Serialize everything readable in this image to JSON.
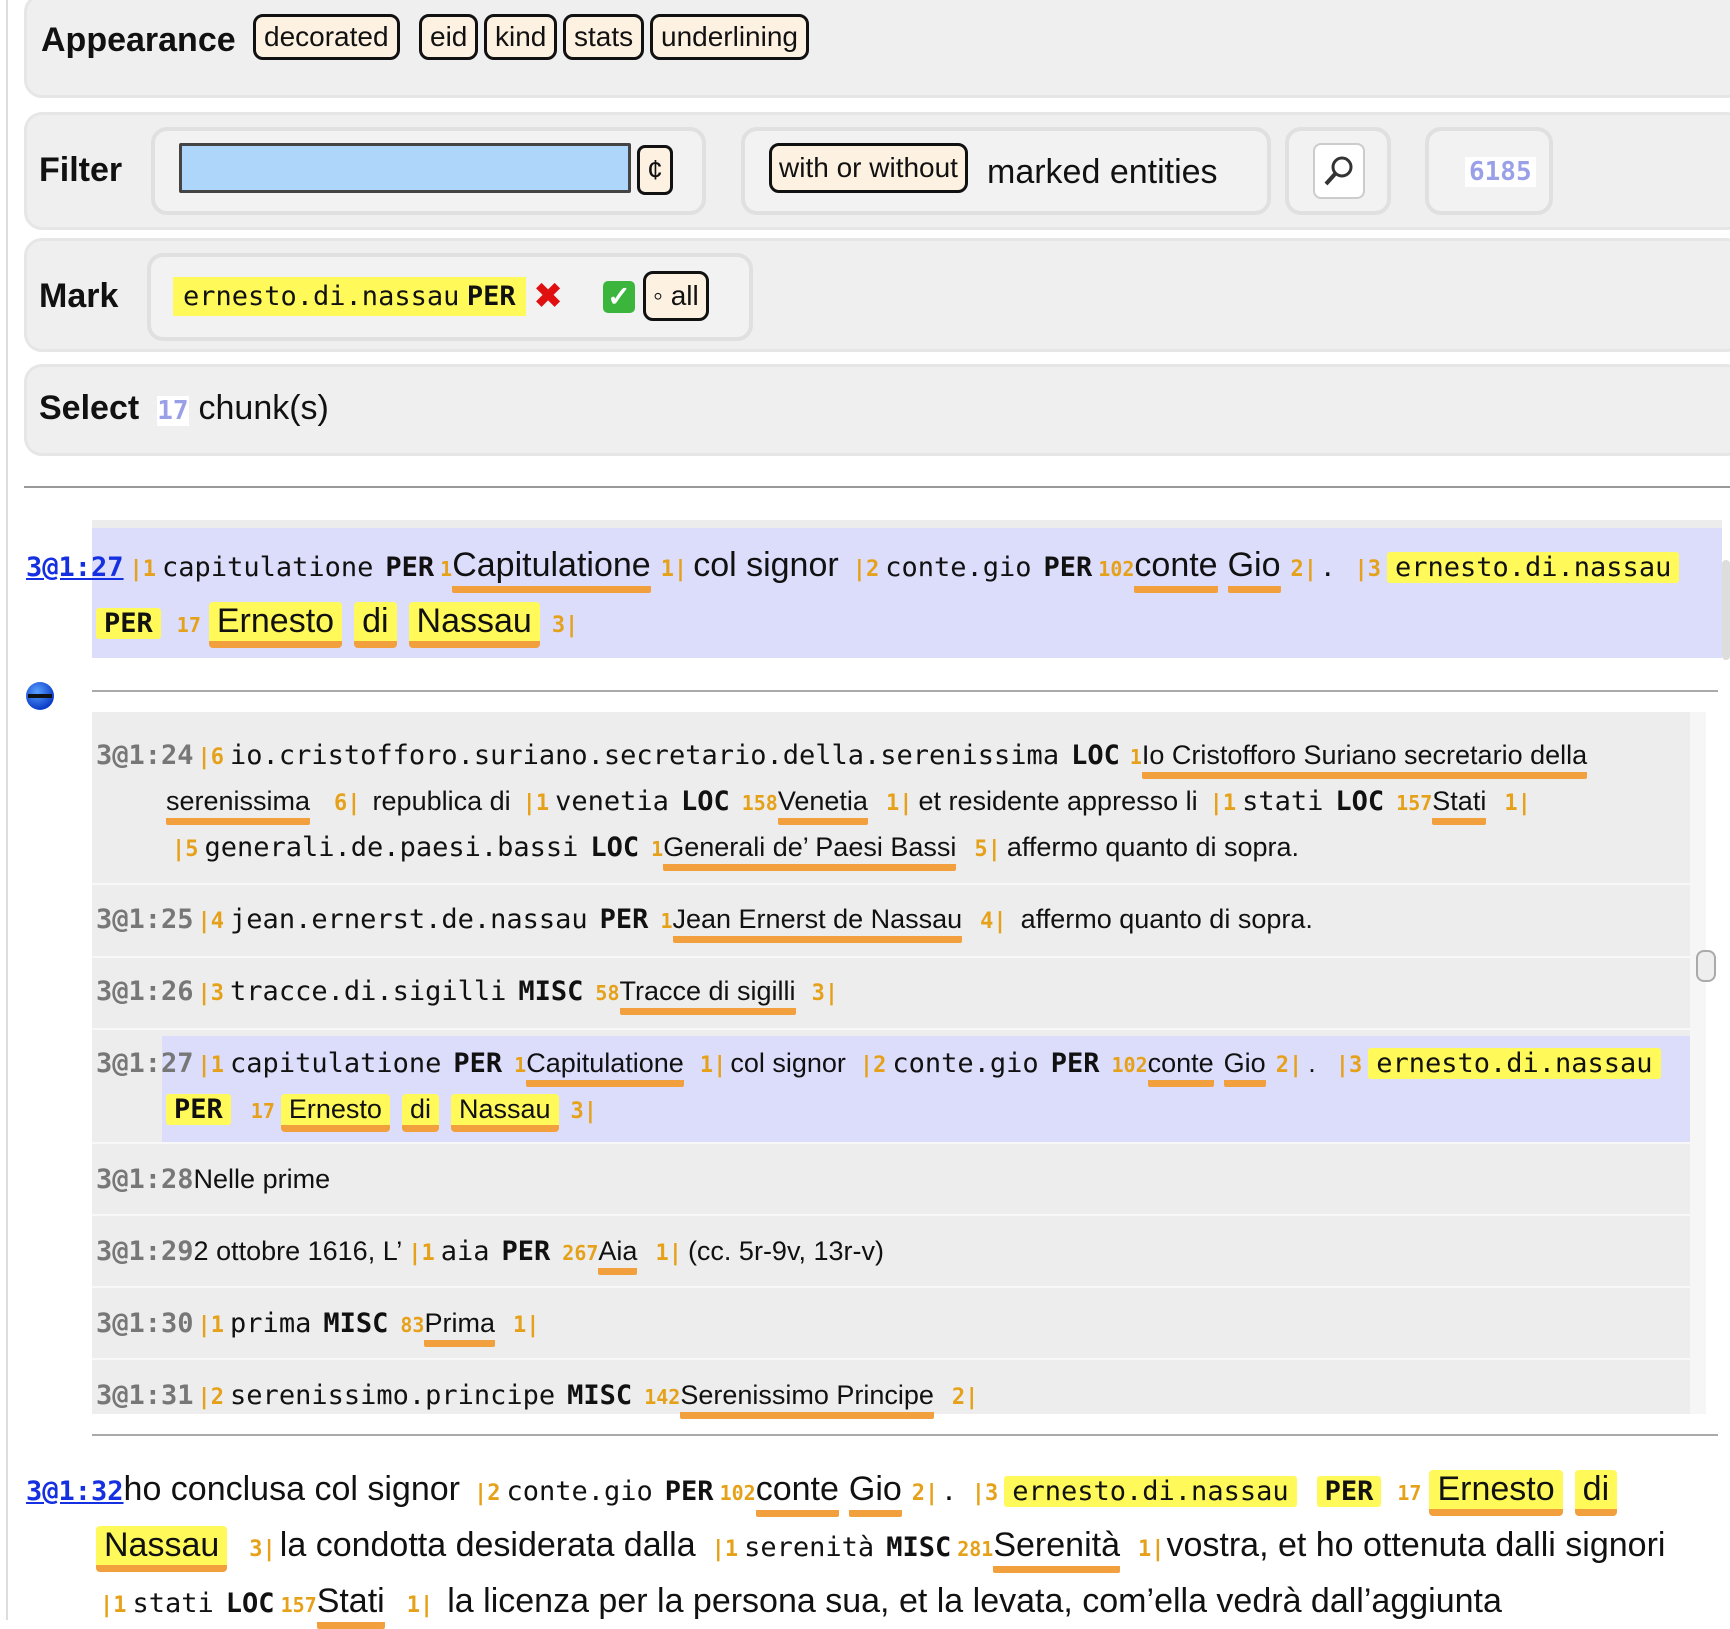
{
  "appearance": {
    "label": "Appearance",
    "options": [
      "decorated",
      "eid",
      "kind",
      "stats",
      "underlining"
    ]
  },
  "filter": {
    "label": "Filter",
    "search_value": "",
    "cent_button": "¢",
    "with_button": "with or without",
    "marked_text": "marked entities",
    "search_icon": "magnifier-icon",
    "count": "6185"
  },
  "mark": {
    "label": "Mark",
    "entity_eid": "ernesto.di.nassau",
    "entity_kind": "PER",
    "remove_glyph": "✖",
    "confirm_glyph": "✅",
    "all_button": "◦ all"
  },
  "select": {
    "label": "Select",
    "count": "17",
    "suffix": "chunk(s)"
  },
  "result": {
    "node": "3@1:27",
    "entities": [
      {
        "bar": "1",
        "eid": "capitulatione",
        "kind": "PER",
        "count": "1",
        "text": "Capitulatione",
        "close": "1"
      },
      {
        "plain": "col signor"
      },
      {
        "bar": "2",
        "eid": "conte.gio",
        "kind": "PER",
        "count": "102",
        "text": [
          "conte",
          "Gio"
        ],
        "close": "2"
      },
      {
        "plain": "."
      },
      {
        "bar": "3",
        "eid": "ernesto.di.nassau",
        "kind": "PER",
        "count": "17",
        "text": [
          "Ernesto",
          "di",
          "Nassau"
        ],
        "close": "3"
      }
    ]
  },
  "context": {
    "toggle_icon": "collapse-icon",
    "rows": [
      {
        "node": "3@1:24",
        "l1": [
          "6",
          "io.cristofforo.suriano.secretario.della.serenissima",
          "LOC",
          "1",
          "Io Cristofforo Suriano secretario della"
        ],
        "l2": [
          "serenissima",
          "6",
          "republica di",
          "1",
          "venetia",
          "LOC",
          "158",
          "Venetia",
          "1",
          "et residente appresso li",
          "1",
          "stati",
          "LOC",
          "157",
          "Stati",
          "1"
        ],
        "l3": [
          "5",
          "generali.de.paesi.bassi",
          "LOC",
          "1",
          "Generali de’ Paesi Bassi",
          "5",
          "affermo quanto di sopra."
        ]
      },
      {
        "node": "3@1:25",
        "bar": "4",
        "eid": "jean.ernerst.de.nassau",
        "kind": "PER",
        "count": "1",
        "text": "Jean Ernerst de Nassau",
        "close": "4",
        "after": "affermo quanto di sopra."
      },
      {
        "node": "3@1:26",
        "bar": "3",
        "eid": "tracce.di.sigilli",
        "kind": "MISC",
        "count": "58",
        "text": "Tracce di sigilli",
        "close": "3"
      },
      {
        "node": "3@1:27"
      },
      {
        "node": "3@1:28",
        "plain": "Nelle prime"
      },
      {
        "node": "3@1:29",
        "before": "2 ottobre 1616, L’",
        "bar": "1",
        "eid": "aia",
        "kind": "PER",
        "count": "267",
        "text": "Aia",
        "close": "1",
        "after": "(cc. 5r-9v, 13r-v)"
      },
      {
        "node": "3@1:30",
        "bar": "1",
        "eid": "prima",
        "kind": "MISC",
        "count": "83",
        "text": "Prima",
        "close": "1"
      },
      {
        "node": "3@1:31",
        "bar": "2",
        "eid": "serenissimo.principe",
        "kind": "MISC",
        "count": "142",
        "text": "Serenissimo Principe",
        "close": "2"
      }
    ]
  },
  "result2": {
    "node": "3@1:32",
    "lead": "ho conclusa col signor",
    "mid1": "la condotta desiderata dalla",
    "serenita": {
      "eid": "serenità",
      "kind": "MISC",
      "count": "281",
      "text": "Serenità"
    },
    "mid2": "vostra, et ho ottenuta dalli signori",
    "stati": {
      "eid": "stati",
      "kind": "LOC",
      "count": "157",
      "text": "Stati"
    },
    "tail": "la licenza per la persona sua, et la levata, com’ella vedrà dall’aggiunta"
  },
  "colors": {
    "accent_underline": "#f2a03e",
    "highlight": "#fffa59",
    "result_bg": "#dcdcfb",
    "count_color": "#9aa0e8",
    "search_bg": "#aed6fb"
  }
}
